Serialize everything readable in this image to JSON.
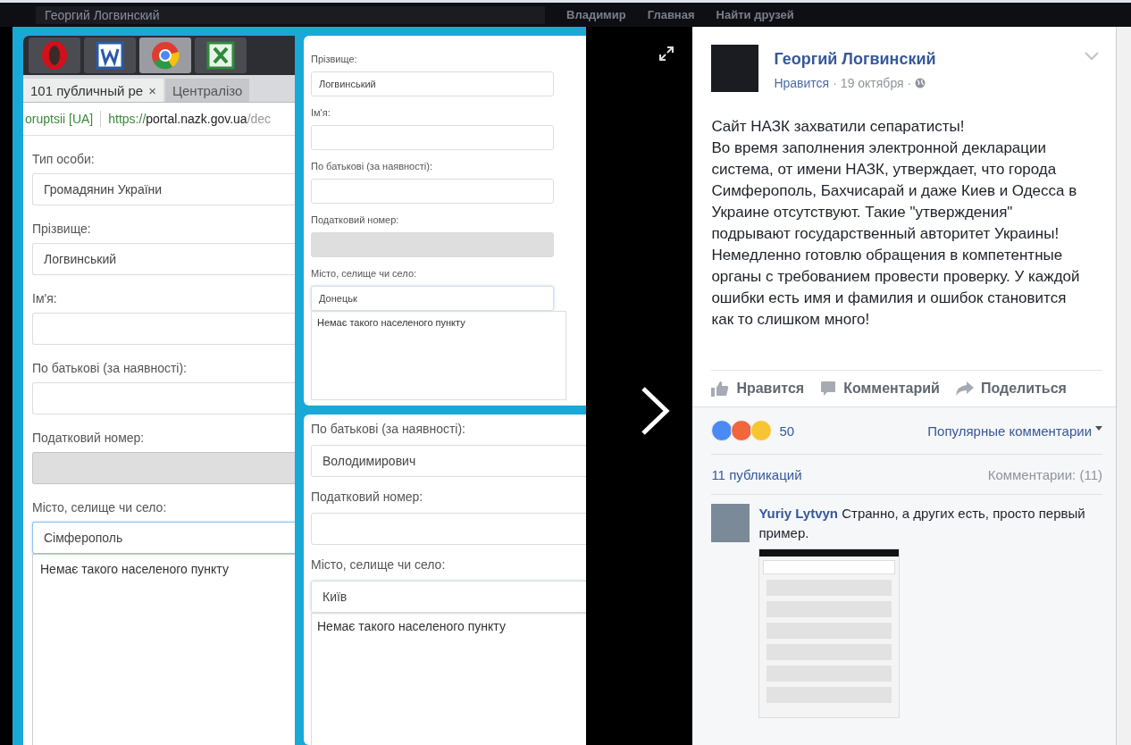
{
  "top_bar": {
    "search_value": "Георгий Логвинский",
    "links": [
      "Владимир",
      "Главная",
      "Найти друзей"
    ]
  },
  "photo": {
    "browser": {
      "apps": [
        {
          "kind": "opera",
          "selected": false
        },
        {
          "kind": "word",
          "selected": false
        },
        {
          "kind": "chrome",
          "selected": true
        },
        {
          "kind": "excel",
          "selected": false
        }
      ],
      "tabs": [
        {
          "title": "101 публичный ре",
          "close": "×",
          "selected": true
        },
        {
          "title": "Централізо",
          "selected": false
        }
      ],
      "url": {
        "site": "oruptsii [UA]",
        "scheme": "https://",
        "host": "portal.nazk.gov.ua",
        "path": "/dec"
      },
      "fields": [
        {
          "label": "Тип особи:",
          "value": "Громадянин України",
          "disabled": false,
          "focused": false
        },
        {
          "label": "Прізвище:",
          "value": "Логвинський",
          "disabled": false,
          "focused": false
        },
        {
          "label": "Ім'я:",
          "disabled": false,
          "focused": false
        },
        {
          "label": "По батькові (за наявності):",
          "disabled": false,
          "focused": false
        },
        {
          "label": "Податковий номер:",
          "disabled": true,
          "focused": false
        },
        {
          "label": "Місто, селище чи село:",
          "value": "Сімферополь",
          "disabled": false,
          "focused": true,
          "message": "Немає такого населеного пункту"
        }
      ]
    },
    "top_card": {
      "fields": [
        {
          "label": "Прізвище:",
          "value": "Логвинський",
          "disabled": false,
          "focused": false
        },
        {
          "label": "Ім'я:",
          "disabled": false,
          "focused": false
        },
        {
          "label": "По батькові (за наявності):",
          "disabled": false,
          "focused": false
        },
        {
          "label": "Податковий номер:",
          "disabled": true,
          "focused": false
        },
        {
          "label": "Місто, селище чи село:",
          "value": "Донецьк",
          "disabled": false,
          "focused": true,
          "message": "Немає такого населеного пункту"
        }
      ]
    },
    "bottom_card": {
      "fields": [
        {
          "label": "По батькові (за наявності):",
          "value": "Володимирович",
          "disabled": false,
          "focused": false
        },
        {
          "label": "Податковий номер:",
          "disabled": false,
          "focused": false
        },
        {
          "label": "Місто, селище чи село:",
          "value": "Київ",
          "disabled": false,
          "focused": true,
          "message": "Немає такого населеного пункту"
        }
      ]
    }
  },
  "post": {
    "author": "Георгий Логвинский",
    "like_link": "Нравится",
    "date": "19 октября",
    "separator": "·",
    "paragraphs": [
      "Сайт НАЗК захватили сепаратисты!",
      "Во время заполнения электронной декларации система, от имени НАЗК, утверждает, что города Симферополь, Бахчисарай и даже Киев и Одесса в Украине отсутствуют. Такие \"утверждения\" подрывают государственный авторитет Украины!",
      "Немедленно готовлю обращения в компетентные органы с требованием провести проверку. У каждой ошибки есть имя и фамилия и ошибок становится как то слишком много!"
    ],
    "actions": [
      {
        "kind": "like",
        "label": "Нравится"
      },
      {
        "kind": "comment",
        "label": "Комментарий"
      },
      {
        "kind": "share",
        "label": "Поделиться"
      }
    ],
    "reactions": {
      "types": [
        {
          "kind": "like"
        },
        {
          "kind": "angry"
        },
        {
          "kind": "haha"
        }
      ],
      "count": "50"
    },
    "sort": "Популярные комментарии",
    "shares": "11 публикаций",
    "comments_count": "Комментарии: (11)",
    "comments": [
      {
        "author": "Yuriy Lytvyn",
        "text": "Странно, а других есть, просто первый пример.",
        "has_attachment": true
      }
    ]
  }
}
